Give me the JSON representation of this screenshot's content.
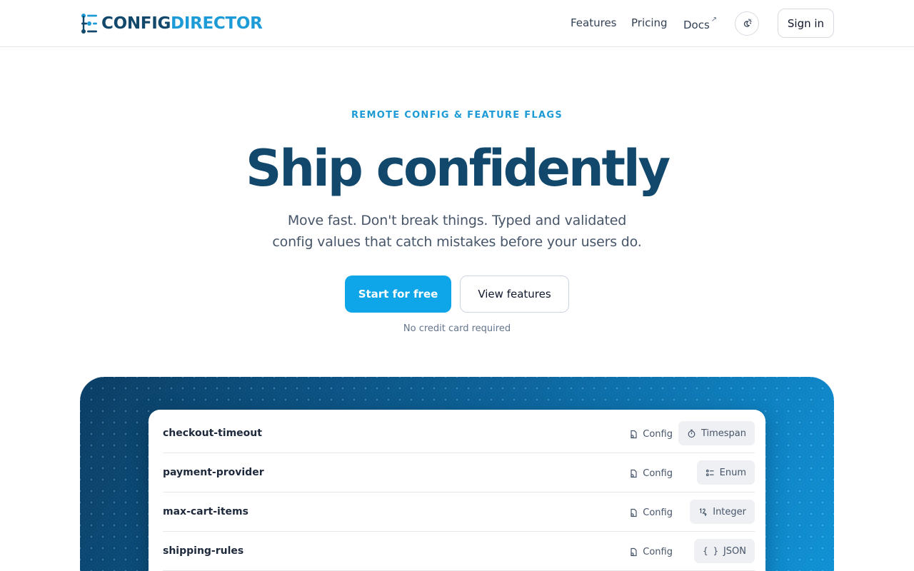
{
  "header": {
    "logo": {
      "word_1": "CONFIG",
      "word_2": "DIRECTOR"
    },
    "nav": [
      {
        "label": "Features"
      },
      {
        "label": "Pricing"
      },
      {
        "label": "Docs",
        "external_glyph": "↗"
      }
    ],
    "theme_toggle_icon": "sun-moon-icon",
    "sign_in_label": "Sign in"
  },
  "hero": {
    "eyebrow": "REMOTE CONFIG & FEATURE FLAGS",
    "title": "Ship confidently",
    "subtitle_line_1": "Move fast. Don't break things. Typed and validated",
    "subtitle_line_2": "config values that catch mistakes before your users do.",
    "primary_cta": "Start for free",
    "secondary_cta": "View features",
    "note": "No credit card required"
  },
  "config_list": [
    {
      "name": "checkout-timeout",
      "kind": "Config",
      "type": "Timespan",
      "type_icon": "stopwatch-icon"
    },
    {
      "name": "payment-provider",
      "kind": "Config",
      "type": "Enum",
      "type_icon": "list-icon"
    },
    {
      "name": "max-cart-items",
      "kind": "Config",
      "type": "Integer",
      "type_icon": "digits-icon"
    },
    {
      "name": "shipping-rules",
      "kind": "Config",
      "type": "JSON",
      "type_icon": "braces-icon",
      "type_glyph": "{ }"
    }
  ],
  "colors": {
    "brand_dark": "#12486b",
    "brand_accent": "#1d9bd7",
    "primary_button": "#0ea5e9",
    "showcase_gradient_start": "#0b3f66",
    "showcase_gradient_end": "#1193d6"
  }
}
